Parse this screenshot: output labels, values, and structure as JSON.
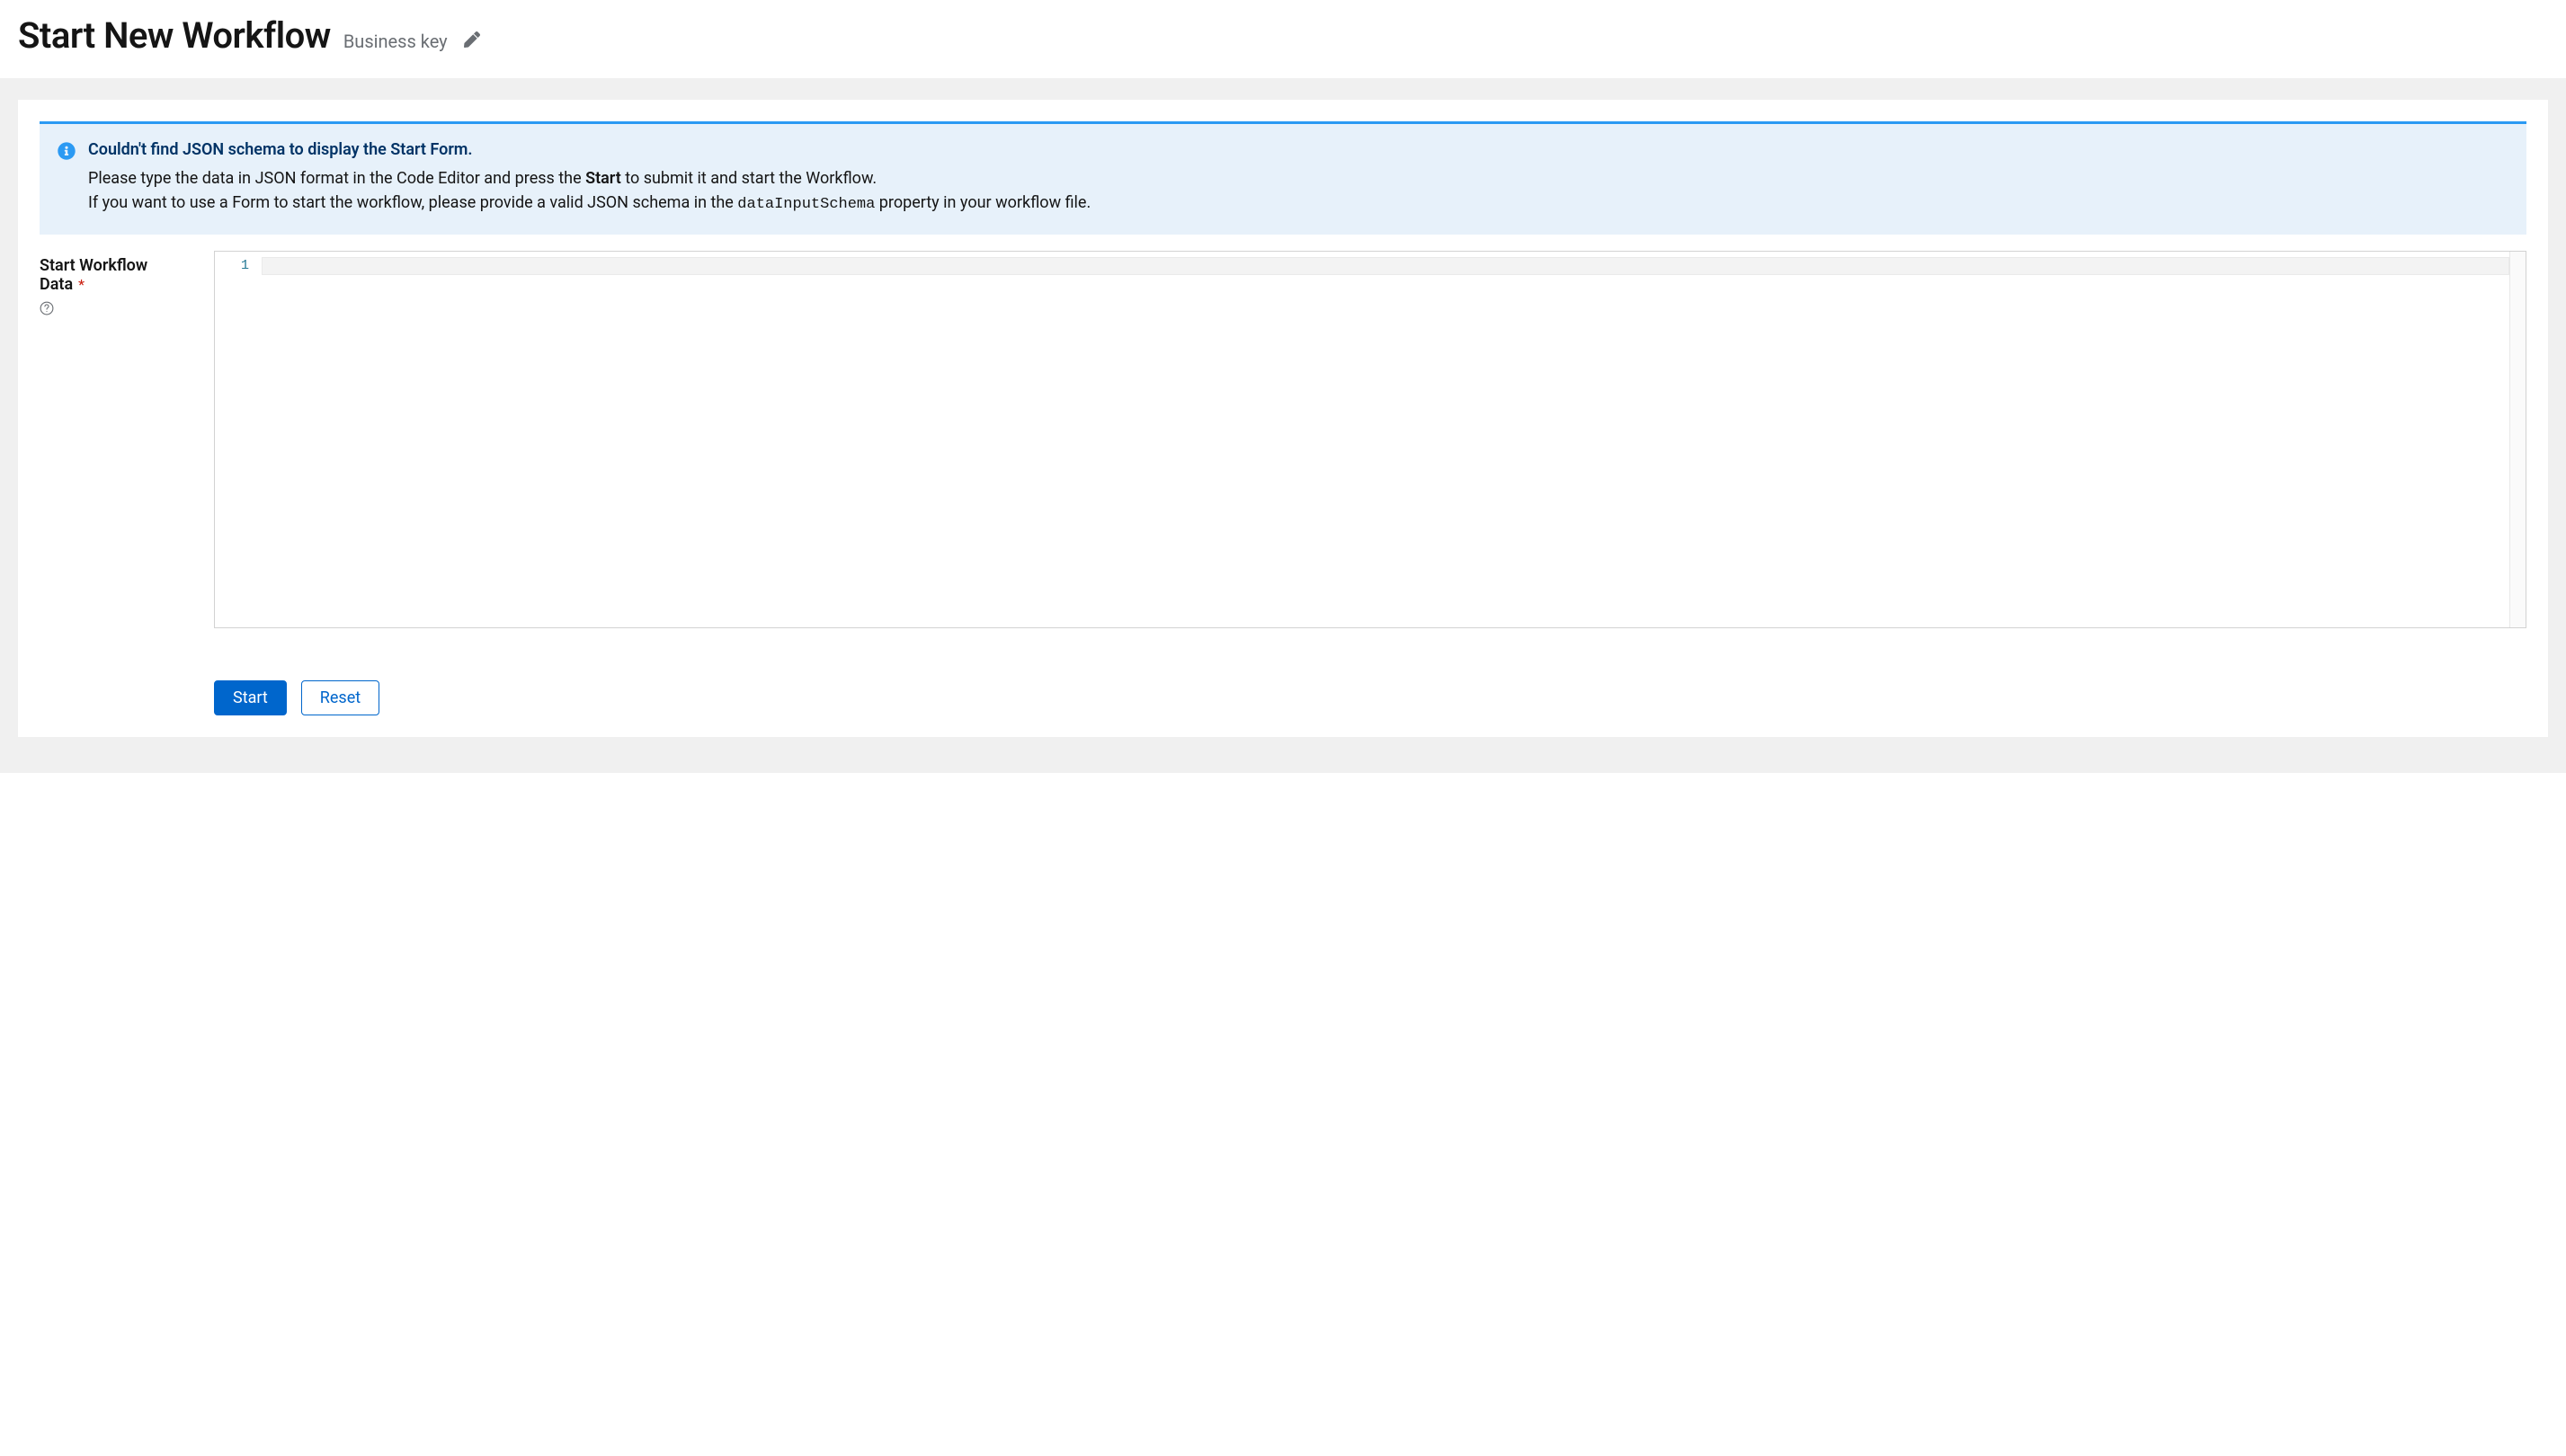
{
  "header": {
    "title": "Start New Workflow",
    "business_key_label": "Business key"
  },
  "alert": {
    "title": "Couldn't find JSON schema to display the Start Form.",
    "line1_pre": "Please type the data in JSON format in the Code Editor and press the ",
    "line1_strong": "Start",
    "line1_post": " to submit it and start the Workflow.",
    "line2_pre": "If you want to use a Form to start the workflow, please provide a valid JSON schema in the ",
    "line2_code": "dataInputSchema",
    "line2_post": " property in your workflow file."
  },
  "form": {
    "label": "Start Workflow Data",
    "required_marker": "*"
  },
  "editor": {
    "gutter_line_1": "1",
    "line_1": ""
  },
  "actions": {
    "start": "Start",
    "reset": "Reset"
  }
}
